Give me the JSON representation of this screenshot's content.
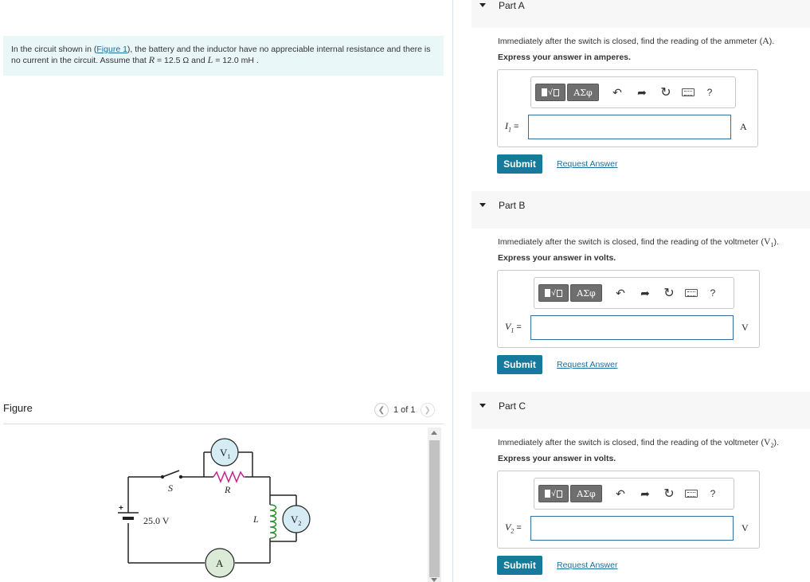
{
  "intro": {
    "before_link": "In the circuit shown in (",
    "link": "Figure 1",
    "after_link": "), the battery and the inductor have no appreciable internal resistance and there is no current in the circuit. Assume that ",
    "r_var": "R",
    "r_value": " = 12.5 Ω and ",
    "l_var": "L",
    "l_value": " = 12.0 mH",
    "end": " ."
  },
  "figure": {
    "title": "Figure",
    "pager": "1 of 1",
    "circuit": {
      "switch": "S",
      "resistor": "R",
      "inductor": "L",
      "battery_voltage": "25.0 V",
      "battery_plus": "+",
      "voltmeter1": "V",
      "voltmeter1_sub": "1",
      "voltmeter2": "V",
      "voltmeter2_sub": "2",
      "ammeter": "A"
    }
  },
  "parts": [
    {
      "title": "Part A",
      "question_pre": "Immediately after the switch is closed, find the reading of the ammeter (",
      "question_sym": "A",
      "question_post": ").",
      "instruction": "Express your answer in amperes.",
      "var": "I",
      "var_sub": "1",
      "eq": " =",
      "unit": "A",
      "value": ""
    },
    {
      "title": "Part B",
      "question_pre": "Immediately after the switch is closed, find the reading of the voltmeter (",
      "question_sym": "V",
      "question_sub": "1",
      "question_post": ").",
      "instruction": "Express your answer in volts.",
      "var": "V",
      "var_sub": "1",
      "eq": " =",
      "unit": "V",
      "value": ""
    },
    {
      "title": "Part C",
      "question_pre": "Immediately after the switch is closed, find the reading of the voltmeter (",
      "question_sym": "V",
      "question_sub": "2",
      "question_post": ").",
      "instruction": "Express your answer in volts.",
      "var": "V",
      "var_sub": "2",
      "eq": " =",
      "unit": "V",
      "value": ""
    }
  ],
  "toolbar": {
    "greek": "ΑΣφ",
    "help": "?",
    "undo_icon": "undo-icon",
    "redo_icon": "redo-icon",
    "reset_icon": "reset-icon",
    "keyboard_icon": "keyboard-icon"
  },
  "buttons": {
    "submit": "Submit",
    "request": "Request Answer"
  },
  "colors": {
    "intro_bg": "#eaf7f9",
    "submit_bg": "#157a9b",
    "link": "#1b6e9b",
    "meter_fill": "#d5ecf5",
    "ammeter_fill": "#dcebd8",
    "resistor_color": "#c2268b",
    "inductor_color": "#2f8f2f"
  }
}
